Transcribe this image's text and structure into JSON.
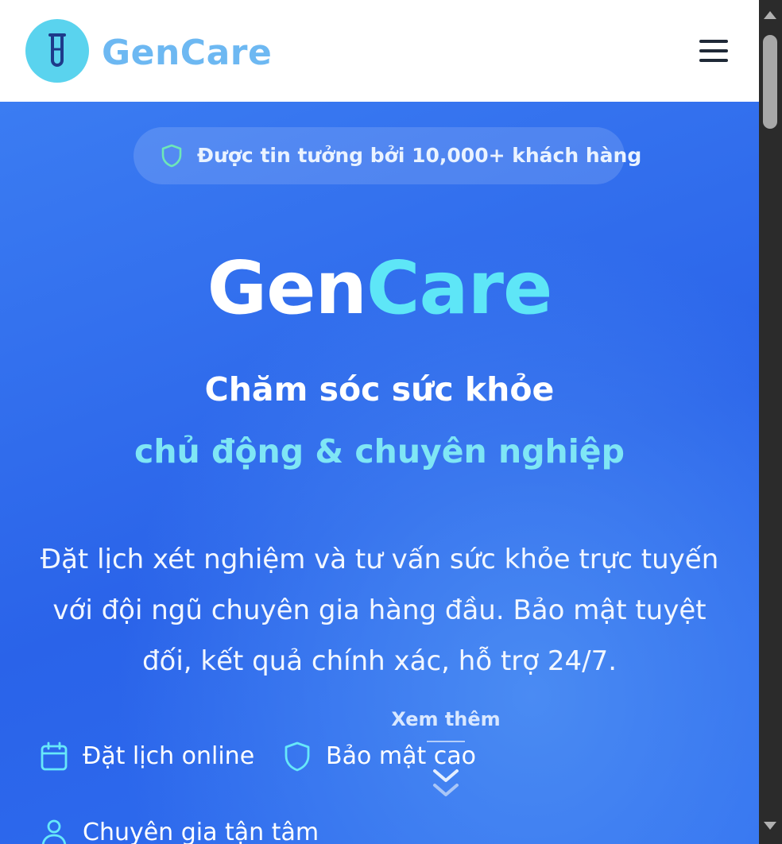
{
  "header": {
    "brand": "GenCare",
    "menu_icon": "hamburger-menu-icon"
  },
  "hero": {
    "trust_badge": "Được tin tưởng bởi 10,000+ khách hàng",
    "brand_part1": "Gen",
    "brand_part2": "Care",
    "tagline_line1": "Chăm sóc sức khỏe",
    "tagline_line2": "chủ động & chuyên nghiệp",
    "description": "Đặt lịch xét nghiệm và tư vấn sức khỏe trực tuyến với đội ngũ chuyên gia hàng đầu. Bảo mật tuyệt đối, kết quả chính xác, hỗ trợ 24/7.",
    "features": [
      {
        "label": "Đặt lịch online",
        "icon": "calendar-icon"
      },
      {
        "label": "Bảo mật cao",
        "icon": "shield-icon"
      },
      {
        "label": "Chuyên gia tận tâm",
        "icon": "user-icon"
      }
    ],
    "see_more": "Xem thêm"
  },
  "colors": {
    "accent_cyan": "#5ee6f7",
    "hero_blue": "#2f6ef0",
    "logo_circle": "#5ad3ee",
    "logo_text": "#6db8f2"
  }
}
